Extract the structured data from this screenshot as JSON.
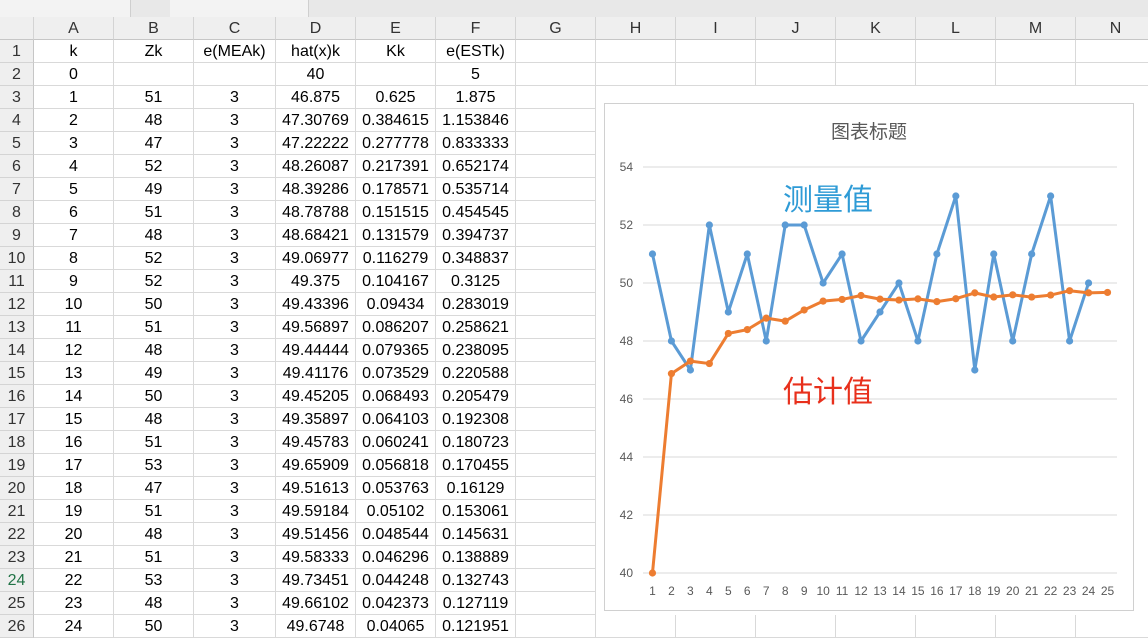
{
  "columns": [
    "A",
    "B",
    "C",
    "D",
    "E",
    "F",
    "G",
    "H",
    "I",
    "J",
    "K",
    "L",
    "M",
    "N"
  ],
  "rows": [
    [
      "k",
      "Zk",
      "e(MEAk)",
      "hat(x)k",
      "Kk",
      "e(ESTk)"
    ],
    [
      "0",
      "",
      "",
      "40",
      "",
      "5"
    ],
    [
      "1",
      "51",
      "3",
      "46.875",
      "0.625",
      "1.875"
    ],
    [
      "2",
      "48",
      "3",
      "47.30769",
      "0.384615",
      "1.153846"
    ],
    [
      "3",
      "47",
      "3",
      "47.22222",
      "0.277778",
      "0.833333"
    ],
    [
      "4",
      "52",
      "3",
      "48.26087",
      "0.217391",
      "0.652174"
    ],
    [
      "5",
      "49",
      "3",
      "48.39286",
      "0.178571",
      "0.535714"
    ],
    [
      "6",
      "51",
      "3",
      "48.78788",
      "0.151515",
      "0.454545"
    ],
    [
      "7",
      "48",
      "3",
      "48.68421",
      "0.131579",
      "0.394737"
    ],
    [
      "8",
      "52",
      "3",
      "49.06977",
      "0.116279",
      "0.348837"
    ],
    [
      "9",
      "52",
      "3",
      "49.375",
      "0.104167",
      "0.3125"
    ],
    [
      "10",
      "50",
      "3",
      "49.43396",
      "0.09434",
      "0.283019"
    ],
    [
      "11",
      "51",
      "3",
      "49.56897",
      "0.086207",
      "0.258621"
    ],
    [
      "12",
      "48",
      "3",
      "49.44444",
      "0.079365",
      "0.238095"
    ],
    [
      "13",
      "49",
      "3",
      "49.41176",
      "0.073529",
      "0.220588"
    ],
    [
      "14",
      "50",
      "3",
      "49.45205",
      "0.068493",
      "0.205479"
    ],
    [
      "15",
      "48",
      "3",
      "49.35897",
      "0.064103",
      "0.192308"
    ],
    [
      "16",
      "51",
      "3",
      "49.45783",
      "0.060241",
      "0.180723"
    ],
    [
      "17",
      "53",
      "3",
      "49.65909",
      "0.056818",
      "0.170455"
    ],
    [
      "18",
      "47",
      "3",
      "49.51613",
      "0.053763",
      "0.16129"
    ],
    [
      "19",
      "51",
      "3",
      "49.59184",
      "0.05102",
      "0.153061"
    ],
    [
      "20",
      "48",
      "3",
      "49.51456",
      "0.048544",
      "0.145631"
    ],
    [
      "21",
      "51",
      "3",
      "49.58333",
      "0.046296",
      "0.138889"
    ],
    [
      "22",
      "53",
      "3",
      "49.73451",
      "0.044248",
      "0.132743"
    ],
    [
      "23",
      "48",
      "3",
      "49.66102",
      "0.042373",
      "0.127119"
    ],
    [
      "24",
      "50",
      "3",
      "49.6748",
      "0.04065",
      "0.121951"
    ]
  ],
  "selected_row": 24,
  "chart_data": {
    "type": "line",
    "title": "图表标题",
    "x": [
      1,
      2,
      3,
      4,
      5,
      6,
      7,
      8,
      9,
      10,
      11,
      12,
      13,
      14,
      15,
      16,
      17,
      18,
      19,
      20,
      21,
      22,
      23,
      24,
      25
    ],
    "ylim": [
      40,
      54
    ],
    "yticks": [
      40,
      42,
      44,
      46,
      48,
      50,
      52,
      54
    ],
    "grid": true,
    "series": [
      {
        "name": "测量值",
        "color": "#5b9bd5",
        "values": [
          51,
          48,
          47,
          52,
          49,
          51,
          48,
          52,
          52,
          50,
          51,
          48,
          49,
          50,
          48,
          51,
          53,
          47,
          51,
          48,
          51,
          53,
          48,
          50,
          null
        ]
      },
      {
        "name": "估计值",
        "color": "#ed7d31",
        "values": [
          40,
          46.875,
          47.30769,
          47.22222,
          48.26087,
          48.39286,
          48.78788,
          48.68421,
          49.06977,
          49.375,
          49.43396,
          49.56897,
          49.44444,
          49.41176,
          49.45205,
          49.35897,
          49.45783,
          49.65909,
          49.51613,
          49.59184,
          49.51456,
          49.58333,
          49.73451,
          49.66102,
          49.6748
        ]
      }
    ],
    "annotations": [
      {
        "text": "测量值",
        "color": "#2e9bd6"
      },
      {
        "text": "估计值",
        "color": "#e8301c"
      }
    ]
  }
}
